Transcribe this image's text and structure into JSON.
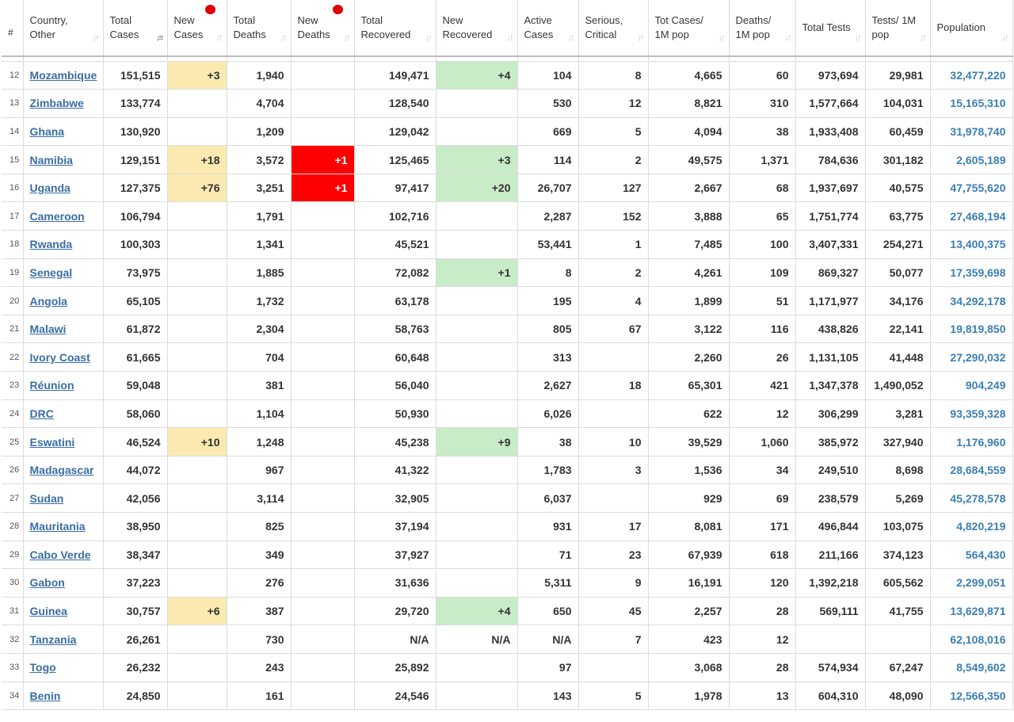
{
  "headers": [
    {
      "key": "idx",
      "label": "#"
    },
    {
      "key": "country",
      "label": "Country, Other"
    },
    {
      "key": "total_cases",
      "label": "Total Cases",
      "sorted": true
    },
    {
      "key": "new_cases",
      "label": "New Cases",
      "dot": true
    },
    {
      "key": "total_deaths",
      "label": "Total Deaths"
    },
    {
      "key": "new_deaths",
      "label": "New Deaths",
      "dot": true
    },
    {
      "key": "total_recovered",
      "label": "Total Recovered"
    },
    {
      "key": "new_recovered",
      "label": "New Recovered"
    },
    {
      "key": "active_cases",
      "label": "Active Cases"
    },
    {
      "key": "serious",
      "label": "Serious, Critical"
    },
    {
      "key": "cases_per_1m",
      "label": "Tot Cases/ 1M pop"
    },
    {
      "key": "deaths_per_1m",
      "label": "Deaths/ 1M pop"
    },
    {
      "key": "total_tests",
      "label": "Total Tests"
    },
    {
      "key": "tests_per_1m",
      "label": "Tests/ 1M pop"
    },
    {
      "key": "population",
      "label": "Population"
    }
  ],
  "colors": {
    "new_cases": "#fbeab0",
    "new_deaths": "#ff0000",
    "new_recovered": "#c8ebc8",
    "link": "#3a6ea5",
    "sort_dot": "#e00000"
  },
  "rows": [
    {
      "idx": "12",
      "country": "Mozambique",
      "total_cases": "151,515",
      "new_cases": "+3",
      "total_deaths": "1,940",
      "new_deaths": "",
      "total_recovered": "149,471",
      "new_recovered": "+4",
      "active_cases": "104",
      "serious": "8",
      "cases_per_1m": "4,665",
      "deaths_per_1m": "60",
      "total_tests": "973,694",
      "tests_per_1m": "29,981",
      "population": "32,477,220"
    },
    {
      "idx": "13",
      "country": "Zimbabwe",
      "total_cases": "133,774",
      "new_cases": "",
      "total_deaths": "4,704",
      "new_deaths": "",
      "total_recovered": "128,540",
      "new_recovered": "",
      "active_cases": "530",
      "serious": "12",
      "cases_per_1m": "8,821",
      "deaths_per_1m": "310",
      "total_tests": "1,577,664",
      "tests_per_1m": "104,031",
      "population": "15,165,310"
    },
    {
      "idx": "14",
      "country": "Ghana",
      "total_cases": "130,920",
      "new_cases": "",
      "total_deaths": "1,209",
      "new_deaths": "",
      "total_recovered": "129,042",
      "new_recovered": "",
      "active_cases": "669",
      "serious": "5",
      "cases_per_1m": "4,094",
      "deaths_per_1m": "38",
      "total_tests": "1,933,408",
      "tests_per_1m": "60,459",
      "population": "31,978,740"
    },
    {
      "idx": "15",
      "country": "Namibia",
      "total_cases": "129,151",
      "new_cases": "+18",
      "total_deaths": "3,572",
      "new_deaths": "+1",
      "total_recovered": "125,465",
      "new_recovered": "+3",
      "active_cases": "114",
      "serious": "2",
      "cases_per_1m": "49,575",
      "deaths_per_1m": "1,371",
      "total_tests": "784,636",
      "tests_per_1m": "301,182",
      "population": "2,605,189"
    },
    {
      "idx": "16",
      "country": "Uganda",
      "total_cases": "127,375",
      "new_cases": "+76",
      "total_deaths": "3,251",
      "new_deaths": "+1",
      "total_recovered": "97,417",
      "new_recovered": "+20",
      "active_cases": "26,707",
      "serious": "127",
      "cases_per_1m": "2,667",
      "deaths_per_1m": "68",
      "total_tests": "1,937,697",
      "tests_per_1m": "40,575",
      "population": "47,755,620"
    },
    {
      "idx": "17",
      "country": "Cameroon",
      "total_cases": "106,794",
      "new_cases": "",
      "total_deaths": "1,791",
      "new_deaths": "",
      "total_recovered": "102,716",
      "new_recovered": "",
      "active_cases": "2,287",
      "serious": "152",
      "cases_per_1m": "3,888",
      "deaths_per_1m": "65",
      "total_tests": "1,751,774",
      "tests_per_1m": "63,775",
      "population": "27,468,194"
    },
    {
      "idx": "18",
      "country": "Rwanda",
      "total_cases": "100,303",
      "new_cases": "",
      "total_deaths": "1,341",
      "new_deaths": "",
      "total_recovered": "45,521",
      "new_recovered": "",
      "active_cases": "53,441",
      "serious": "1",
      "cases_per_1m": "7,485",
      "deaths_per_1m": "100",
      "total_tests": "3,407,331",
      "tests_per_1m": "254,271",
      "population": "13,400,375"
    },
    {
      "idx": "19",
      "country": "Senegal",
      "total_cases": "73,975",
      "new_cases": "",
      "total_deaths": "1,885",
      "new_deaths": "",
      "total_recovered": "72,082",
      "new_recovered": "+1",
      "active_cases": "8",
      "serious": "2",
      "cases_per_1m": "4,261",
      "deaths_per_1m": "109",
      "total_tests": "869,327",
      "tests_per_1m": "50,077",
      "population": "17,359,698"
    },
    {
      "idx": "20",
      "country": "Angola",
      "total_cases": "65,105",
      "new_cases": "",
      "total_deaths": "1,732",
      "new_deaths": "",
      "total_recovered": "63,178",
      "new_recovered": "",
      "active_cases": "195",
      "serious": "4",
      "cases_per_1m": "1,899",
      "deaths_per_1m": "51",
      "total_tests": "1,171,977",
      "tests_per_1m": "34,176",
      "population": "34,292,178"
    },
    {
      "idx": "21",
      "country": "Malawi",
      "total_cases": "61,872",
      "new_cases": "",
      "total_deaths": "2,304",
      "new_deaths": "",
      "total_recovered": "58,763",
      "new_recovered": "",
      "active_cases": "805",
      "serious": "67",
      "cases_per_1m": "3,122",
      "deaths_per_1m": "116",
      "total_tests": "438,826",
      "tests_per_1m": "22,141",
      "population": "19,819,850"
    },
    {
      "idx": "22",
      "country": "Ivory Coast",
      "total_cases": "61,665",
      "new_cases": "",
      "total_deaths": "704",
      "new_deaths": "",
      "total_recovered": "60,648",
      "new_recovered": "",
      "active_cases": "313",
      "serious": "",
      "cases_per_1m": "2,260",
      "deaths_per_1m": "26",
      "total_tests": "1,131,105",
      "tests_per_1m": "41,448",
      "population": "27,290,032"
    },
    {
      "idx": "23",
      "country": "Réunion",
      "total_cases": "59,048",
      "new_cases": "",
      "total_deaths": "381",
      "new_deaths": "",
      "total_recovered": "56,040",
      "new_recovered": "",
      "active_cases": "2,627",
      "serious": "18",
      "cases_per_1m": "65,301",
      "deaths_per_1m": "421",
      "total_tests": "1,347,378",
      "tests_per_1m": "1,490,052",
      "population": "904,249"
    },
    {
      "idx": "24",
      "country": "DRC",
      "total_cases": "58,060",
      "new_cases": "",
      "total_deaths": "1,104",
      "new_deaths": "",
      "total_recovered": "50,930",
      "new_recovered": "",
      "active_cases": "6,026",
      "serious": "",
      "cases_per_1m": "622",
      "deaths_per_1m": "12",
      "total_tests": "306,299",
      "tests_per_1m": "3,281",
      "population": "93,359,328"
    },
    {
      "idx": "25",
      "country": "Eswatini",
      "total_cases": "46,524",
      "new_cases": "+10",
      "total_deaths": "1,248",
      "new_deaths": "",
      "total_recovered": "45,238",
      "new_recovered": "+9",
      "active_cases": "38",
      "serious": "10",
      "cases_per_1m": "39,529",
      "deaths_per_1m": "1,060",
      "total_tests": "385,972",
      "tests_per_1m": "327,940",
      "population": "1,176,960"
    },
    {
      "idx": "26",
      "country": "Madagascar",
      "total_cases": "44,072",
      "new_cases": "",
      "total_deaths": "967",
      "new_deaths": "",
      "total_recovered": "41,322",
      "new_recovered": "",
      "active_cases": "1,783",
      "serious": "3",
      "cases_per_1m": "1,536",
      "deaths_per_1m": "34",
      "total_tests": "249,510",
      "tests_per_1m": "8,698",
      "population": "28,684,559"
    },
    {
      "idx": "27",
      "country": "Sudan",
      "total_cases": "42,056",
      "new_cases": "",
      "total_deaths": "3,114",
      "new_deaths": "",
      "total_recovered": "32,905",
      "new_recovered": "",
      "active_cases": "6,037",
      "serious": "",
      "cases_per_1m": "929",
      "deaths_per_1m": "69",
      "total_tests": "238,579",
      "tests_per_1m": "5,269",
      "population": "45,278,578"
    },
    {
      "idx": "28",
      "country": "Mauritania",
      "total_cases": "38,950",
      "new_cases": "",
      "total_deaths": "825",
      "new_deaths": "",
      "total_recovered": "37,194",
      "new_recovered": "",
      "active_cases": "931",
      "serious": "17",
      "cases_per_1m": "8,081",
      "deaths_per_1m": "171",
      "total_tests": "496,844",
      "tests_per_1m": "103,075",
      "population": "4,820,219"
    },
    {
      "idx": "29",
      "country": "Cabo Verde",
      "total_cases": "38,347",
      "new_cases": "",
      "total_deaths": "349",
      "new_deaths": "",
      "total_recovered": "37,927",
      "new_recovered": "",
      "active_cases": "71",
      "serious": "23",
      "cases_per_1m": "67,939",
      "deaths_per_1m": "618",
      "total_tests": "211,166",
      "tests_per_1m": "374,123",
      "population": "564,430"
    },
    {
      "idx": "30",
      "country": "Gabon",
      "total_cases": "37,223",
      "new_cases": "",
      "total_deaths": "276",
      "new_deaths": "",
      "total_recovered": "31,636",
      "new_recovered": "",
      "active_cases": "5,311",
      "serious": "9",
      "cases_per_1m": "16,191",
      "deaths_per_1m": "120",
      "total_tests": "1,392,218",
      "tests_per_1m": "605,562",
      "population": "2,299,051"
    },
    {
      "idx": "31",
      "country": "Guinea",
      "total_cases": "30,757",
      "new_cases": "+6",
      "total_deaths": "387",
      "new_deaths": "",
      "total_recovered": "29,720",
      "new_recovered": "+4",
      "active_cases": "650",
      "serious": "45",
      "cases_per_1m": "2,257",
      "deaths_per_1m": "28",
      "total_tests": "569,111",
      "tests_per_1m": "41,755",
      "population": "13,629,871"
    },
    {
      "idx": "32",
      "country": "Tanzania",
      "total_cases": "26,261",
      "new_cases": "",
      "total_deaths": "730",
      "new_deaths": "",
      "total_recovered": "N/A",
      "new_recovered": "N/A",
      "active_cases": "N/A",
      "serious": "7",
      "cases_per_1m": "423",
      "deaths_per_1m": "12",
      "total_tests": "",
      "tests_per_1m": "",
      "population": "62,108,016"
    },
    {
      "idx": "33",
      "country": "Togo",
      "total_cases": "26,232",
      "new_cases": "",
      "total_deaths": "243",
      "new_deaths": "",
      "total_recovered": "25,892",
      "new_recovered": "",
      "active_cases": "97",
      "serious": "",
      "cases_per_1m": "3,068",
      "deaths_per_1m": "28",
      "total_tests": "574,934",
      "tests_per_1m": "67,247",
      "population": "8,549,602"
    },
    {
      "idx": "34",
      "country": "Benin",
      "total_cases": "24,850",
      "new_cases": "",
      "total_deaths": "161",
      "new_deaths": "",
      "total_recovered": "24,546",
      "new_recovered": "",
      "active_cases": "143",
      "serious": "5",
      "cases_per_1m": "1,978",
      "deaths_per_1m": "13",
      "total_tests": "604,310",
      "tests_per_1m": "48,090",
      "population": "12,566,350"
    }
  ]
}
